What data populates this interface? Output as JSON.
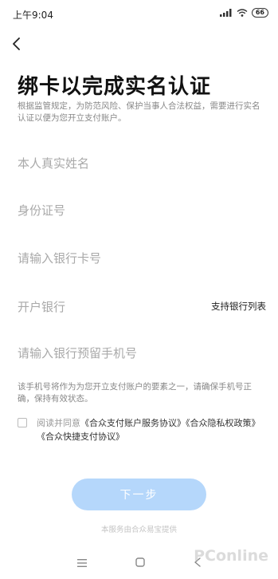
{
  "status_bar": {
    "time": "上午9:04",
    "battery": "66"
  },
  "header": {
    "title": "绑卡以完成实名认证",
    "description": "根据监管规定，为防范风险、保护当事人合法权益，需要进行实名认证以便为您开立支付账户。"
  },
  "form": {
    "name_placeholder": "本人真实姓名",
    "id_placeholder": "身份证号",
    "card_placeholder": "请输入银行卡号",
    "bank_label": "开户银行",
    "bank_support_link": "支持银行列表",
    "phone_placeholder": "请输入银行预留手机号",
    "phone_hint": "该手机号将作为为您开立支付账户的要素之一，请确保手机号正确，保持有效状态。"
  },
  "agreement": {
    "prefix": "阅读并同意",
    "links": "《合众支付账户服务协议》《合众隐私权政策》《合众快捷支付协议》"
  },
  "next_button": "下一步",
  "footer_note": "本服务由合众易宝提供",
  "watermark": "PConline"
}
